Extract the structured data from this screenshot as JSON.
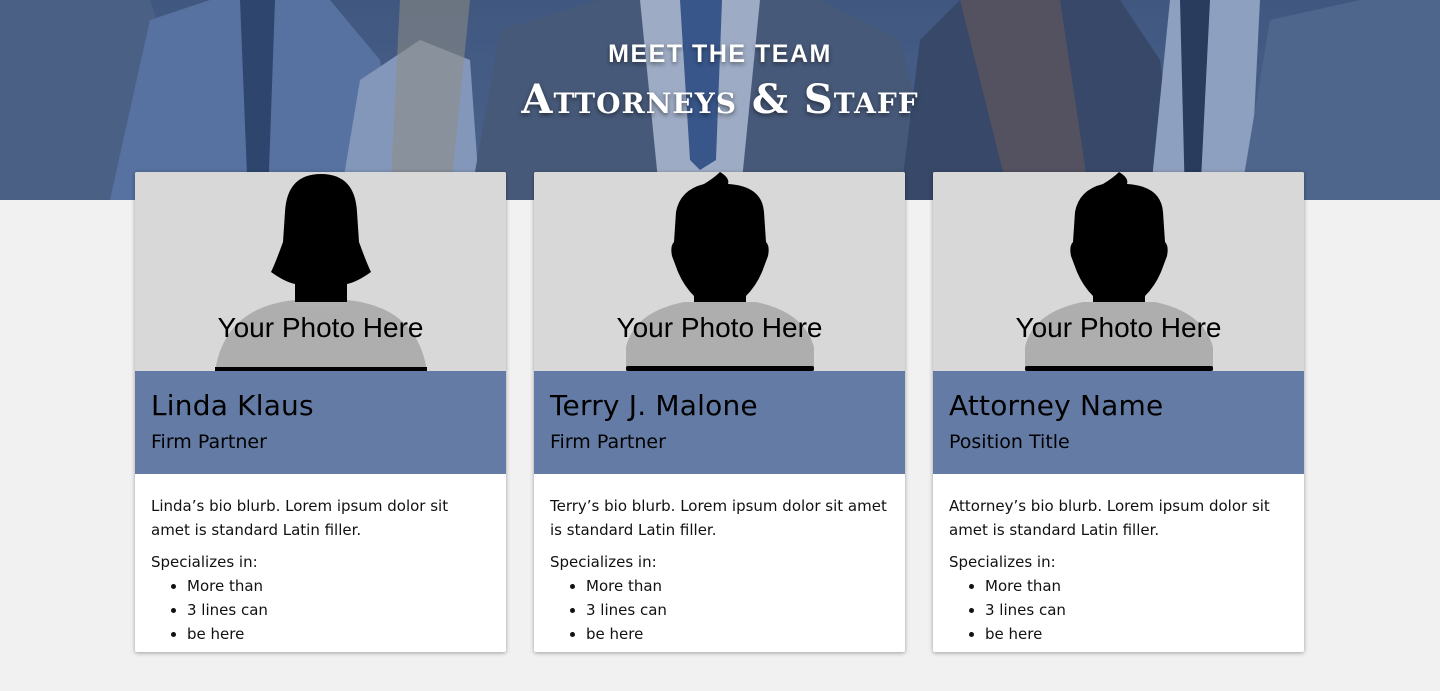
{
  "header": {
    "kicker": "MEET THE TEAM",
    "title": "Attorneys & Staff"
  },
  "colors": {
    "name_bar": "#647ca5",
    "page_background": "#f1f1f1",
    "photo_placeholder": "#d8d8d8"
  },
  "team": [
    {
      "photo_label": "Your Photo Here",
      "silhouette": "female-silhouette-icon",
      "name": "Linda Klaus",
      "position": "Firm Partner",
      "bio": "Linda’s bio blurb. Lorem ipsum dolor sit amet is standard Latin filler.",
      "specializes_label": "Specializes in:",
      "specialties": [
        "More than",
        "3 lines can",
        "be here"
      ]
    },
    {
      "photo_label": "Your Photo Here",
      "silhouette": "male-silhouette-icon",
      "name": "Terry J. Malone",
      "position": "Firm Partner",
      "bio": "Terry’s bio blurb. Lorem ipsum dolor sit amet is standard Latin filler.",
      "specializes_label": "Specializes in:",
      "specialties": [
        "More than",
        "3 lines can",
        "be here"
      ]
    },
    {
      "photo_label": "Your Photo Here",
      "silhouette": "male-silhouette-icon",
      "name": "Attorney Name",
      "position": "Position Title",
      "bio": "Attorney’s bio blurb. Lorem ipsum dolor sit amet is standard Latin filler.",
      "specializes_label": "Specializes in:",
      "specialties": [
        "More than",
        "3 lines can",
        "be here"
      ]
    }
  ]
}
